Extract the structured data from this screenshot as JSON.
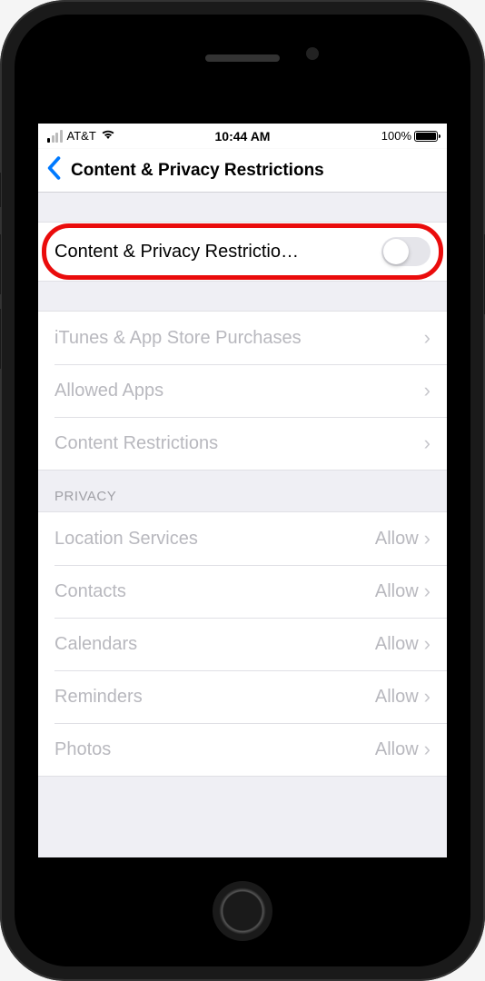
{
  "status": {
    "carrier": "AT&T",
    "time": "10:44 AM",
    "battery_pct": "100%"
  },
  "nav": {
    "title": "Content & Privacy Restrictions"
  },
  "toggle": {
    "label": "Content & Privacy Restrictio…",
    "on": false
  },
  "group1": [
    {
      "label": "iTunes & App Store Purchases"
    },
    {
      "label": "Allowed Apps"
    },
    {
      "label": "Content Restrictions"
    }
  ],
  "privacy": {
    "header": "PRIVACY",
    "items": [
      {
        "label": "Location Services",
        "value": "Allow"
      },
      {
        "label": "Contacts",
        "value": "Allow"
      },
      {
        "label": "Calendars",
        "value": "Allow"
      },
      {
        "label": "Reminders",
        "value": "Allow"
      },
      {
        "label": "Photos",
        "value": "Allow"
      }
    ]
  }
}
